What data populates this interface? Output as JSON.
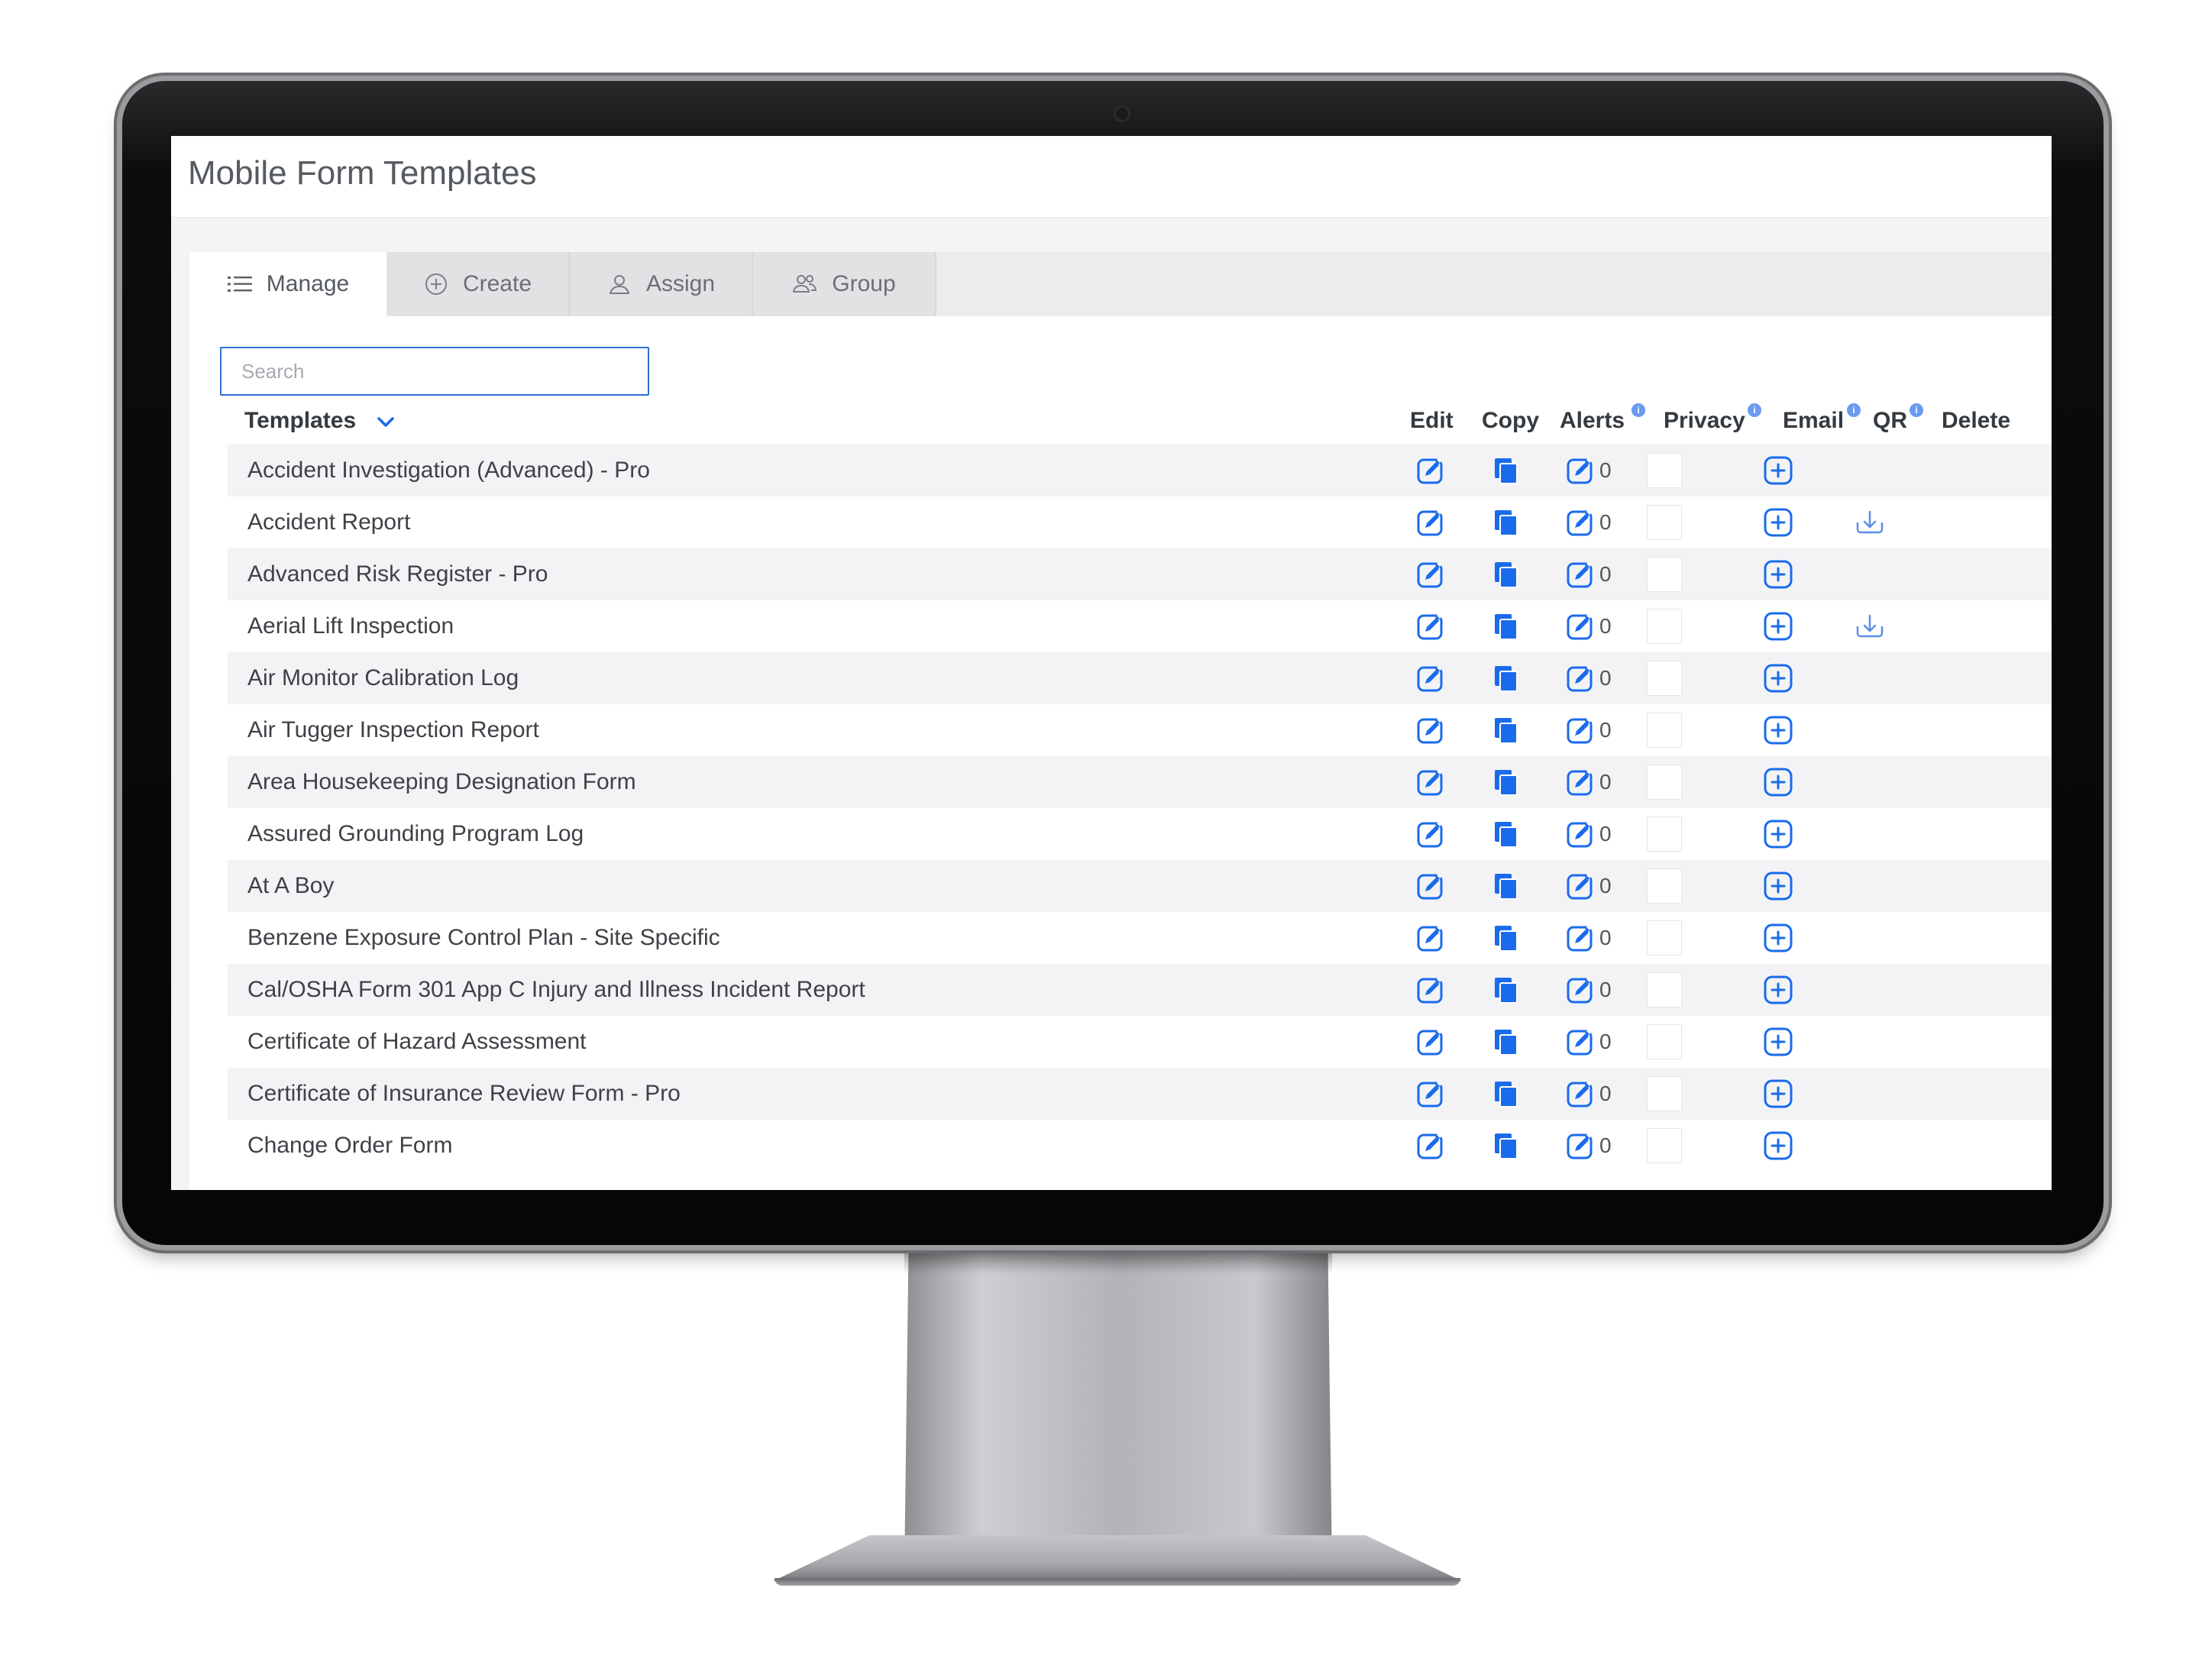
{
  "app": {
    "title": "Mobile Form Templates"
  },
  "tabs": [
    {
      "label": "Manage",
      "icon": "list-icon",
      "active": true
    },
    {
      "label": "Create",
      "icon": "plus-circle-icon",
      "active": false
    },
    {
      "label": "Assign",
      "icon": "user-icon",
      "active": false
    },
    {
      "label": "Group",
      "icon": "users-icon",
      "active": false
    }
  ],
  "search": {
    "placeholder": "Search",
    "value": ""
  },
  "table": {
    "columns": {
      "templates": "Templates",
      "edit": "Edit",
      "copy": "Copy",
      "alerts": "Alerts",
      "privacy": "Privacy",
      "email": "Email",
      "qr": "QR",
      "delete": "Delete"
    },
    "rows": [
      {
        "name": "Accident Investigation (Advanced) - Pro",
        "alerts": "0",
        "qr": false
      },
      {
        "name": "Accident Report",
        "alerts": "0",
        "qr": true
      },
      {
        "name": "Advanced Risk Register - Pro",
        "alerts": "0",
        "qr": false
      },
      {
        "name": "Aerial Lift Inspection",
        "alerts": "0",
        "qr": true
      },
      {
        "name": "Air Monitor Calibration Log",
        "alerts": "0",
        "qr": false
      },
      {
        "name": "Air Tugger Inspection Report",
        "alerts": "0",
        "qr": false
      },
      {
        "name": "Area Housekeeping Designation Form",
        "alerts": "0",
        "qr": false
      },
      {
        "name": "Assured Grounding Program Log",
        "alerts": "0",
        "qr": false
      },
      {
        "name": "At A Boy",
        "alerts": "0",
        "qr": false
      },
      {
        "name": "Benzene Exposure Control Plan - Site Specific",
        "alerts": "0",
        "qr": false
      },
      {
        "name": "Cal/OSHA Form 301 App C Injury and Illness Incident Report",
        "alerts": "0",
        "qr": false
      },
      {
        "name": "Certificate of Hazard Assessment",
        "alerts": "0",
        "qr": false
      },
      {
        "name": "Certificate of Insurance Review Form - Pro",
        "alerts": "0",
        "qr": false
      },
      {
        "name": "Change Order Form",
        "alerts": "0",
        "qr": false
      }
    ]
  },
  "colors": {
    "accent": "#1a6bec",
    "info": "#6b9bf0",
    "text": "#3e4247"
  },
  "icons": {
    "edit": "edit-icon",
    "copy": "copy-icon",
    "alert": "alert-edit-icon",
    "email": "plus-square-icon",
    "qr": "download-icon",
    "sort": "chevron-down-icon"
  }
}
